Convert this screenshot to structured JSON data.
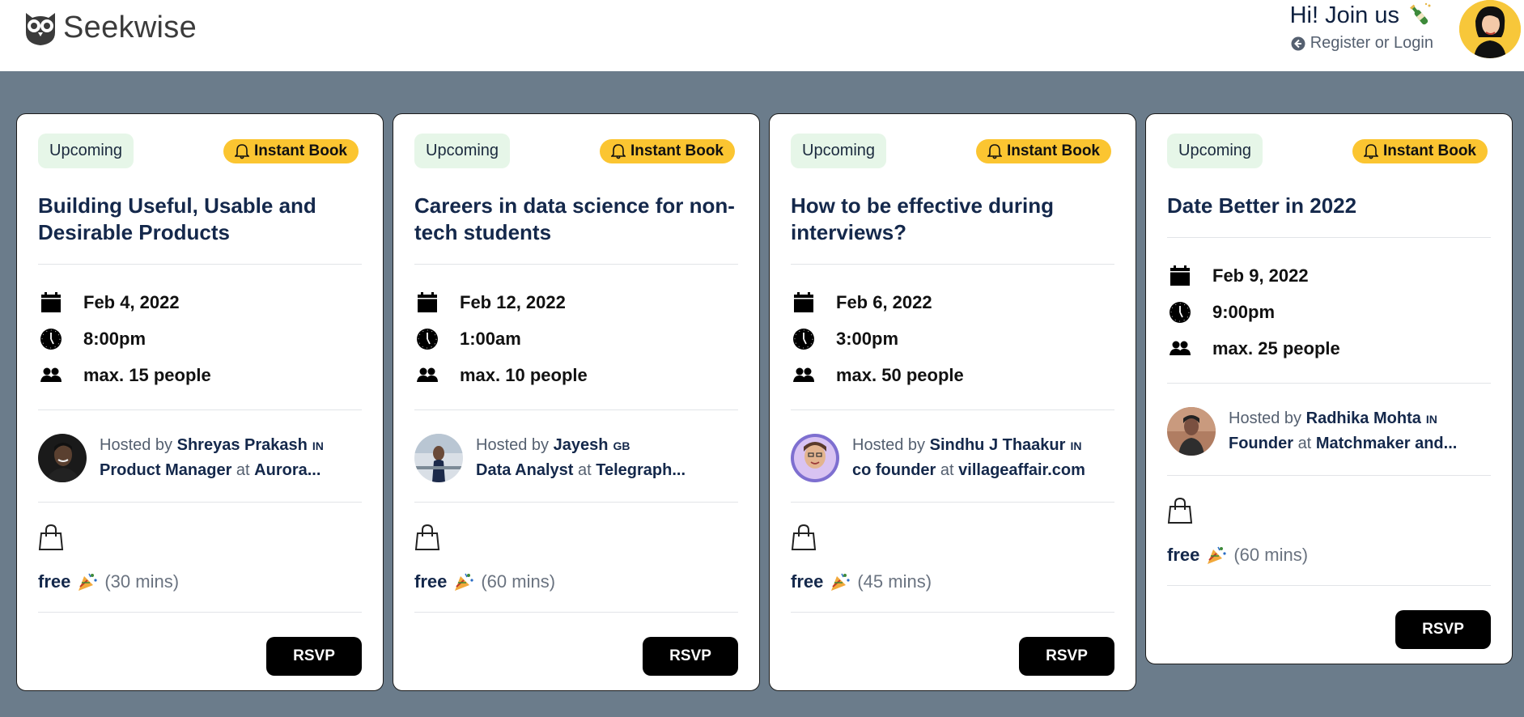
{
  "header": {
    "brand": "Seekwise",
    "join_title": "Hi! Join us",
    "join_link": "Register or Login"
  },
  "cards": [
    {
      "status": "Upcoming",
      "badge": "Instant Book",
      "title": "Building Useful, Usable and Desirable Products",
      "date": "Feb 4, 2022",
      "time": "8:00pm",
      "capacity": "max. 15 people",
      "hosted_by": "Hosted by",
      "host_name": "Shreyas Prakash",
      "host_country": "IN",
      "host_role": "Product Manager",
      "at": "at",
      "host_company": "Aurora...",
      "price": "free",
      "duration": "(30 mins)",
      "rsvp": "RSVP"
    },
    {
      "status": "Upcoming",
      "badge": "Instant Book",
      "title": "Careers in data science for non-tech students",
      "date": "Feb 12, 2022",
      "time": "1:00am",
      "capacity": "max. 10 people",
      "hosted_by": "Hosted by",
      "host_name": "Jayesh",
      "host_country": "GB",
      "host_role": "Data Analyst",
      "at": "at",
      "host_company": "Telegraph...",
      "price": "free",
      "duration": "(60 mins)",
      "rsvp": "RSVP"
    },
    {
      "status": "Upcoming",
      "badge": "Instant Book",
      "title": "How to be effective during interviews?",
      "date": "Feb 6, 2022",
      "time": "3:00pm",
      "capacity": "max. 50 people",
      "hosted_by": "Hosted by",
      "host_name": "Sindhu J Thaakur",
      "host_country": "IN",
      "host_role": "co founder",
      "at": "at",
      "host_company": "villageaffair.com",
      "price": "free",
      "duration": "(45 mins)",
      "rsvp": "RSVP"
    },
    {
      "status": "Upcoming",
      "badge": "Instant Book",
      "title": "Date Better in 2022",
      "date": "Feb 9, 2022",
      "time": "9:00pm",
      "capacity": "max. 25 people",
      "hosted_by": "Hosted by",
      "host_name": "Radhika Mohta",
      "host_country": "IN",
      "host_role": "Founder",
      "at": "at",
      "host_company": "Matchmaker and...",
      "price": "free",
      "duration": "(60 mins)",
      "rsvp": "RSVP"
    }
  ]
}
